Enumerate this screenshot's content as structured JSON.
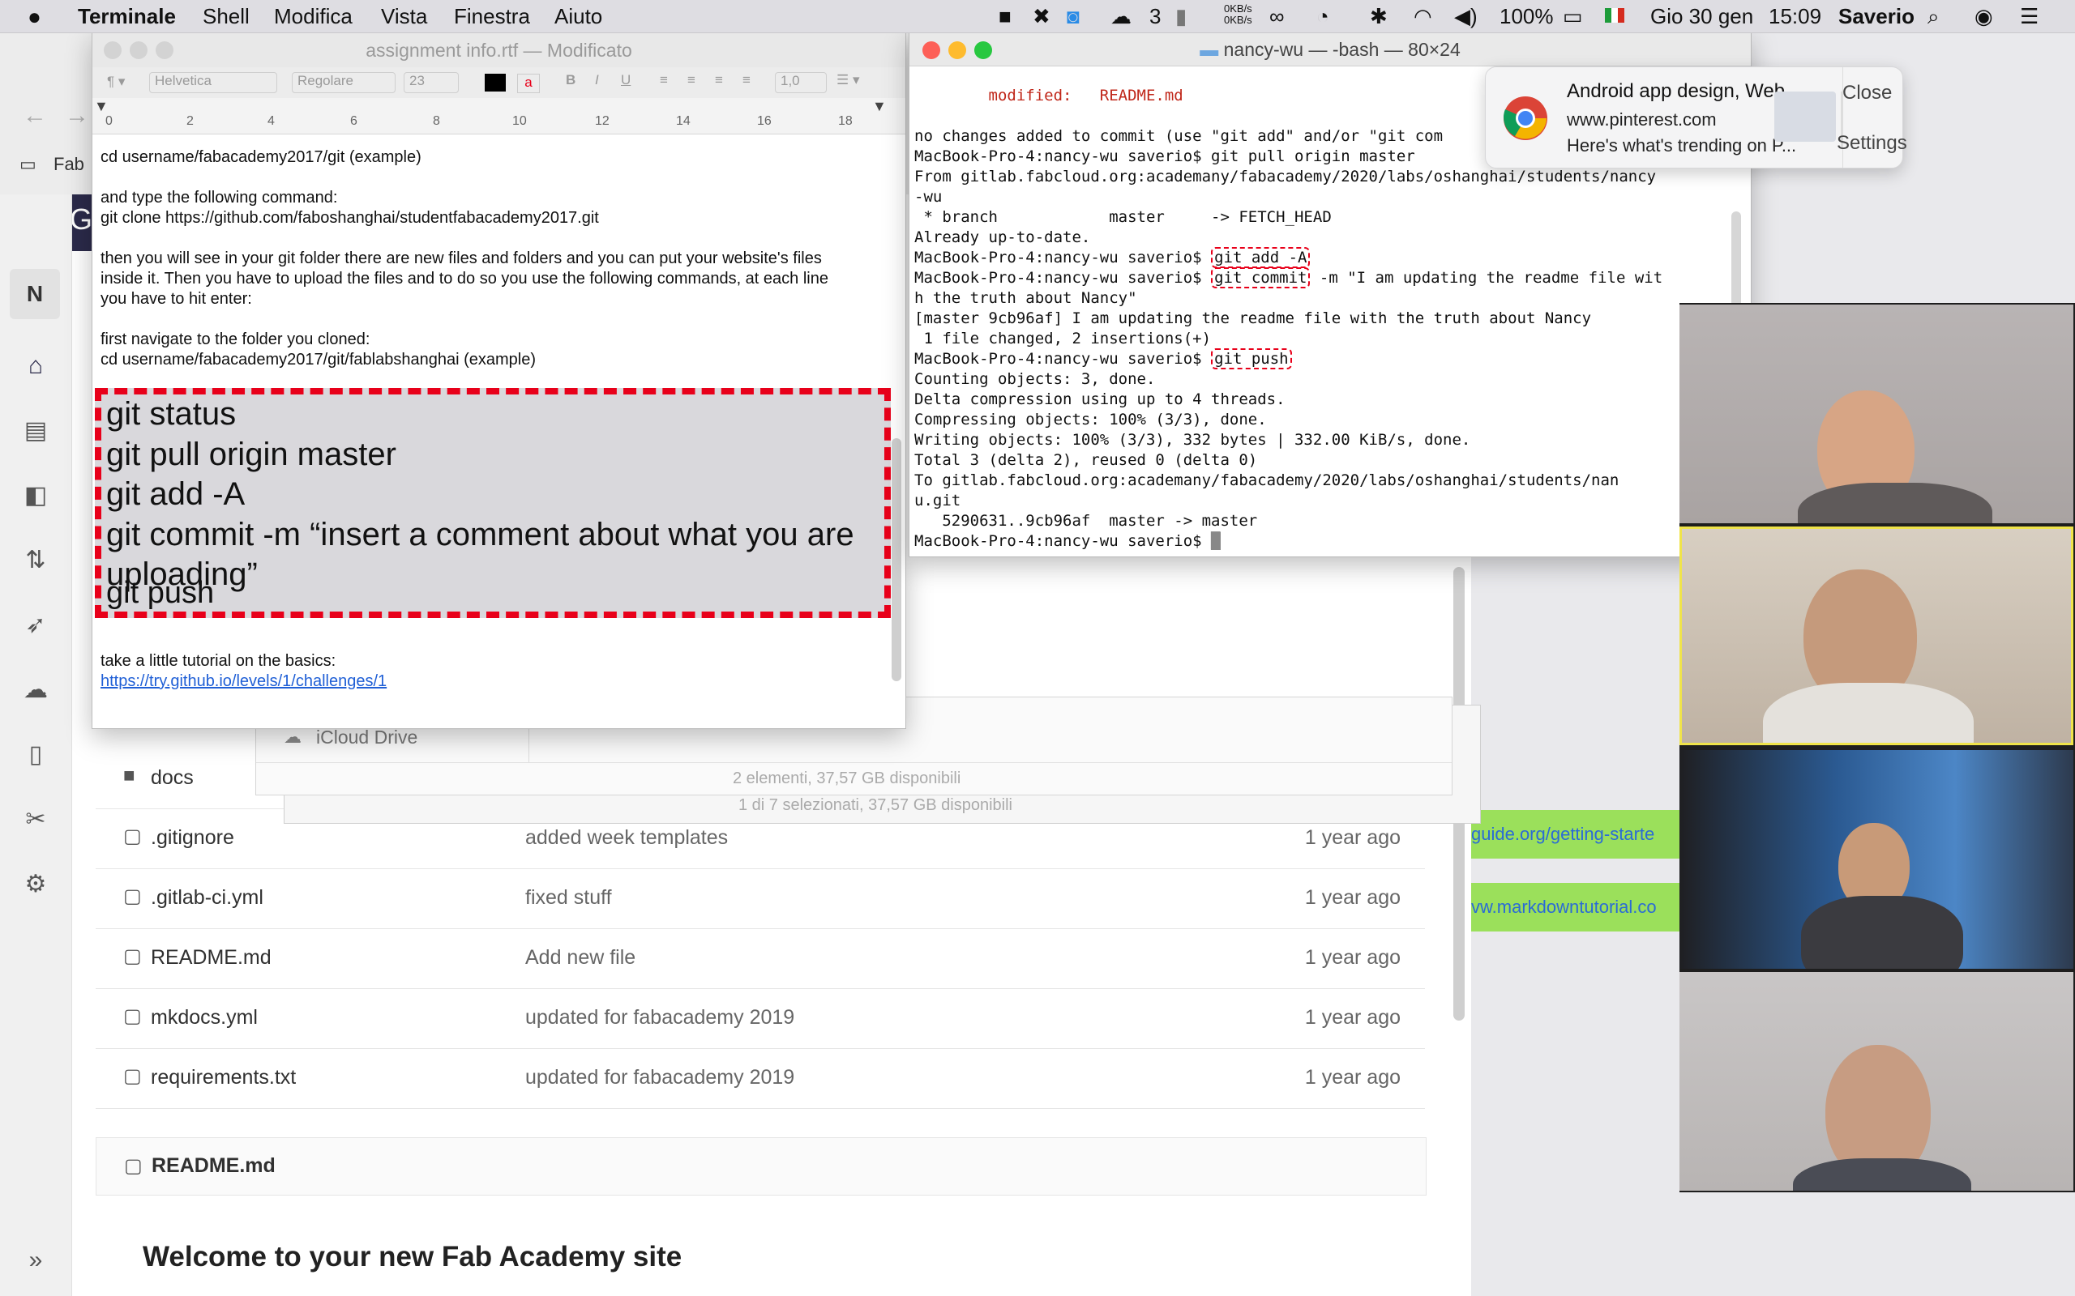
{
  "menubar": {
    "app": "Terminale",
    "items": [
      "Shell",
      "Modifica",
      "Vista",
      "Finestra",
      "Aiuto"
    ],
    "status": {
      "net_up": "0KB/s",
      "net_down": "0KB/s",
      "wechat_count": "3",
      "battery": "100%",
      "date": "Gio 30 gen",
      "time": "15:09",
      "user": "Saverio"
    }
  },
  "gitlab": {
    "brand_initial": "G",
    "bookmark": "Fab",
    "nav_badge": "N",
    "files": [
      {
        "name": "docs",
        "type": "folder",
        "commit": "",
        "time": ""
      },
      {
        "name": ".gitignore",
        "type": "file",
        "commit": "added week templates",
        "time": "1 year ago"
      },
      {
        "name": ".gitlab-ci.yml",
        "type": "file",
        "commit": "fixed stuff",
        "time": "1 year ago"
      },
      {
        "name": "README.md",
        "type": "file",
        "commit": "Add new file",
        "time": "1 year ago"
      },
      {
        "name": "mkdocs.yml",
        "type": "file",
        "commit": "updated for fabacademy 2019",
        "time": "1 year ago"
      },
      {
        "name": "requirements.txt",
        "type": "file",
        "commit": "updated for fabacademy 2019",
        "time": "1 year ago"
      }
    ],
    "readme_header": "README.md",
    "readme_title": "Welcome to your new Fab Academy site",
    "links": [
      "guide.org/getting-starte",
      "vw.markdowntutorial.co"
    ]
  },
  "finder": {
    "sidebar_item": "iCloud Drive",
    "status_front": "2 elementi, 37,57 GB disponibili",
    "status_back": "1 di 7 selezionati, 37,57 GB disponibili"
  },
  "textedit": {
    "title": "assignment info.rtf — Modificato",
    "font": "Helvetica",
    "style": "Regolare",
    "size": "23",
    "spacing": "1,0",
    "ruler": [
      "0",
      "2",
      "4",
      "6",
      "8",
      "10",
      "12",
      "14",
      "16",
      "18"
    ],
    "lines": [
      "cd username/fabacademy2017/git (example)",
      "and type the following command:",
      "git clone https://github.com/faboshanghai/studentfabacademy2017.git",
      "then you will see in your git folder there are new files and folders and you can put your website's files",
      "inside it. Then you have to upload the files and to do so you use the following commands, at each line",
      "you have to hit enter:",
      "first navigate to the folder you cloned:",
      "cd username/fabacademy2017/git/fablabshanghai (example)"
    ],
    "commands": [
      "git status",
      "git pull origin master",
      "git add -A",
      "git commit -m “insert a comment about what you are",
      "uploading”",
      "git push"
    ],
    "footer_text": "take a little tutorial on the basics:",
    "footer_link": "https://try.github.io/levels/1/challenges/1"
  },
  "terminal": {
    "title": "nancy-wu — -bash — 80×24",
    "prompt": "MacBook-Pro-4:nancy-wu saverio$",
    "modified": "        modified:   README.md",
    "l1": "no changes added to commit (use \"git add\" and/or \"git com",
    "cmd_pull": " git pull origin master",
    "l3": "From gitlab.fabcloud.org:academany/fabacademy/2020/labs/oshanghai/students/nancy",
    "l4": "-wu",
    "l5": " * branch            master     -> FETCH_HEAD",
    "l6": "Already up-to-date.",
    "cmd_add": "git add -A",
    "cmd_commit": "git commit",
    "commit_rest": " -m \"I am updating the readme file wit",
    "l9": "h the truth about Nancy\"",
    "l10": "[master 9cb96af] I am updating the readme file with the truth about Nancy",
    "l11": " 1 file changed, 2 insertions(+)",
    "cmd_push": "git push",
    "l13": "Counting objects: 3, done.",
    "l14": "Delta compression using up to 4 threads.",
    "l15": "Compressing objects: 100% (3/3), done.",
    "l16": "Writing objects: 100% (3/3), 332 bytes | 332.00 KiB/s, done.",
    "l17": "Total 3 (delta 2), reused 0 (delta 0)",
    "l18": "To gitlab.fabcloud.org:academany/fabacademy/2020/labs/oshanghai/students/nan",
    "l19": "u.git",
    "l20": "   5290631..9cb96af  master -> master"
  },
  "notification": {
    "title": "Android app design, Web...",
    "site": "www.pinterest.com",
    "body": "Here's what's trending on P...",
    "close": "Close",
    "settings": "Settings"
  },
  "colors": {
    "accent_red": "#e8001a",
    "gitlab_dark": "#2b2a4a",
    "link_green": "#9be05b"
  }
}
